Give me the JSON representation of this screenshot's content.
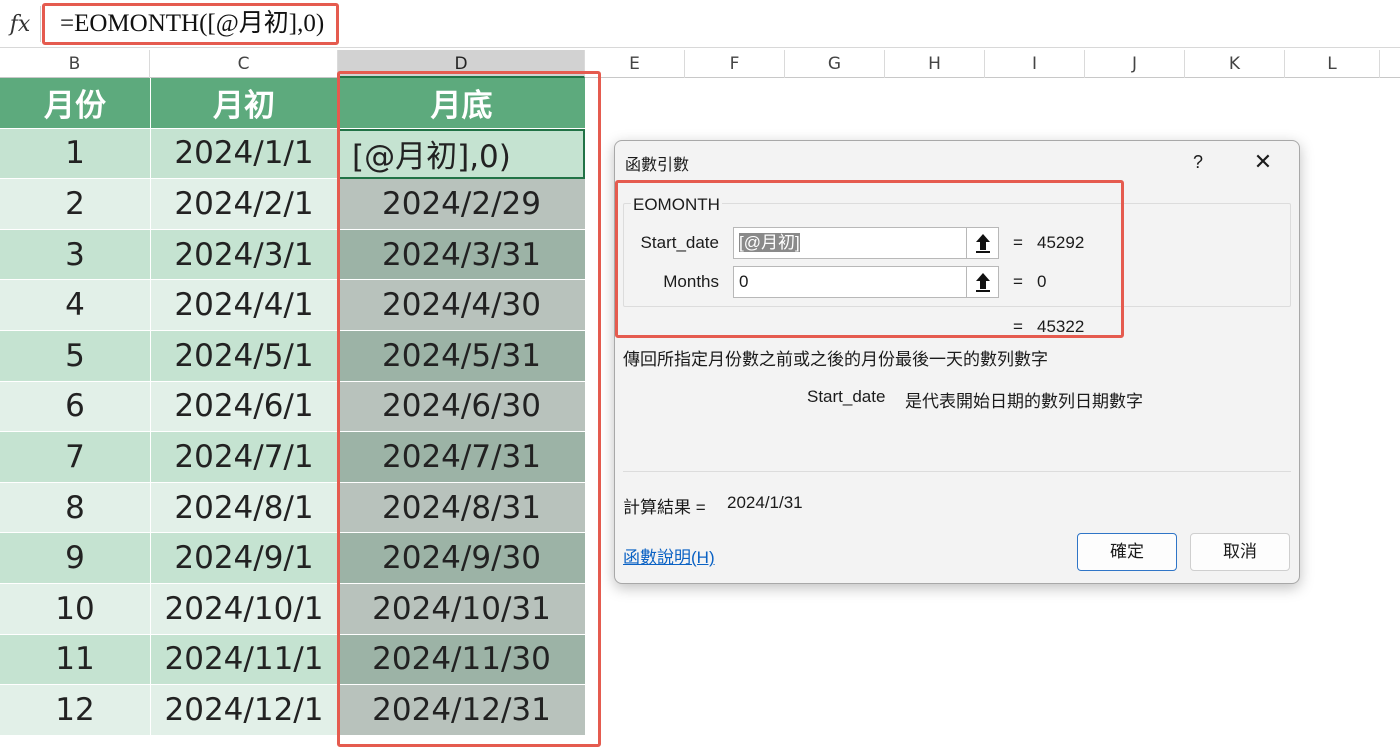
{
  "formula_bar": {
    "fx": "fx",
    "formula": "=EOMONTH([@月初],0)"
  },
  "columns": [
    "B",
    "C",
    "D",
    "E",
    "F",
    "G",
    "H",
    "I",
    "J",
    "K",
    "L"
  ],
  "table": {
    "headers": [
      "月份",
      "月初",
      "月底"
    ],
    "rows": [
      [
        "1",
        "2024/1/1",
        "[@月初],0)"
      ],
      [
        "2",
        "2024/2/1",
        "2024/2/29"
      ],
      [
        "3",
        "2024/3/1",
        "2024/3/31"
      ],
      [
        "4",
        "2024/4/1",
        "2024/4/30"
      ],
      [
        "5",
        "2024/5/1",
        "2024/5/31"
      ],
      [
        "6",
        "2024/6/1",
        "2024/6/30"
      ],
      [
        "7",
        "2024/7/1",
        "2024/7/31"
      ],
      [
        "8",
        "2024/8/1",
        "2024/8/31"
      ],
      [
        "9",
        "2024/9/1",
        "2024/9/30"
      ],
      [
        "10",
        "2024/10/1",
        "2024/10/31"
      ],
      [
        "11",
        "2024/11/1",
        "2024/11/30"
      ],
      [
        "12",
        "2024/12/1",
        "2024/12/31"
      ]
    ]
  },
  "dialog": {
    "title": "函數引數",
    "help": "?",
    "close": "✕",
    "function_name": "EOMONTH",
    "args": [
      {
        "label": "Start_date",
        "value": "[@月初]",
        "eq": "=",
        "result": "45292"
      },
      {
        "label": "Months",
        "value": "0",
        "eq": "=",
        "result": "0"
      }
    ],
    "total_eq": "=",
    "total": "45322",
    "description": "傳回所指定月份數之前或之後的月份最後一天的數列數字",
    "arg_desc_name": "Start_date",
    "arg_desc_text": "是代表開始日期的數列日期數字",
    "result_label": "計算結果 =",
    "result_value": "2024/1/31",
    "help_link": "函數說明(H)",
    "ok": "確定",
    "cancel": "取消"
  },
  "colors": {
    "header_green": "#5daa7d",
    "row_green_dark": "#c5e3d1",
    "row_green_light": "#e2f0e8",
    "highlight_red": "#e55b4f",
    "link_blue": "#0b62c4"
  }
}
